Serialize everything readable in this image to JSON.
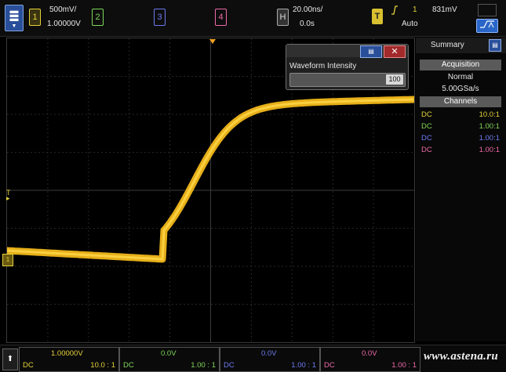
{
  "top": {
    "ch1": {
      "num": "1",
      "scale": "500mV/",
      "offset": "1.00000V",
      "color": "#e6d23a"
    },
    "ch2": {
      "num": "2",
      "color": "#7fd85a"
    },
    "ch3": {
      "num": "3",
      "color": "#6c7cf0"
    },
    "ch4": {
      "num": "4",
      "color": "#ee6aa8"
    },
    "h_label": "H",
    "timebase": "20.00ns/",
    "delay": "0.0s",
    "t_label": "T",
    "trig_slope_icon": "rising-edge-icon",
    "trig_source": "1",
    "trig_level": "831mV",
    "trig_mode": "Auto"
  },
  "side": {
    "title": "Summary",
    "acq_header": "Acquisition",
    "acq_mode": "Normal",
    "sample_rate": "5.00GSa/s",
    "channels_header": "Channels",
    "channels": [
      {
        "coupling": "DC",
        "probe": "10.0:1",
        "color": "#e6d23a"
      },
      {
        "coupling": "DC",
        "probe": "1.00:1",
        "color": "#7fd85a"
      },
      {
        "coupling": "DC",
        "probe": "1.00:1",
        "color": "#6c7cf0"
      },
      {
        "coupling": "DC",
        "probe": "1.00:1",
        "color": "#ee6aa8"
      }
    ]
  },
  "dialog": {
    "label": "Waveform Intensity",
    "value": "100"
  },
  "bottom": {
    "slots": [
      {
        "value": "1.00000V",
        "coupling": "DC",
        "probe": "10.0 : 1",
        "color": "#e6d23a"
      },
      {
        "value": "0.0V",
        "coupling": "DC",
        "probe": "1.00 : 1",
        "color": "#7fd85a"
      },
      {
        "value": "0.0V",
        "coupling": "DC",
        "probe": "1.00 : 1",
        "color": "#6c7cf0"
      },
      {
        "value": "0.0V",
        "coupling": "DC",
        "probe": "1.00 : 1",
        "color": "#ee6aa8"
      }
    ],
    "watermark": "www.astena.ru"
  },
  "waveform": {
    "color": "#f2b81a"
  }
}
